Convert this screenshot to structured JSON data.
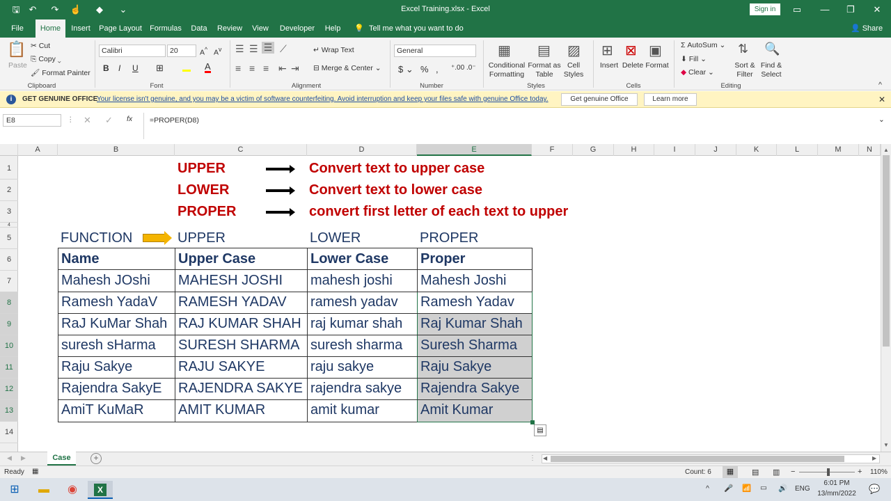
{
  "titlebar": {
    "title": "Excel Training.xlsx  -  Excel",
    "signin": "Sign in"
  },
  "tabs": [
    "File",
    "Home",
    "Insert",
    "Page Layout",
    "Formulas",
    "Data",
    "Review",
    "View",
    "Developer",
    "Help"
  ],
  "tellme": "Tell me what you want to do",
  "share": "Share",
  "ribbon": {
    "clipboard": {
      "paste": "Paste",
      "cut": "Cut",
      "copy": "Copy",
      "format_painter": "Format Painter",
      "label": "Clipboard"
    },
    "font": {
      "name": "Calibri",
      "size": "20",
      "label": "Font"
    },
    "alignment": {
      "wrap": "Wrap Text",
      "merge": "Merge & Center",
      "label": "Alignment"
    },
    "number": {
      "format": "General",
      "label": "Number"
    },
    "styles": {
      "conditional": "Conditional\nFormatting",
      "format_table": "Format as\nTable",
      "cell_styles": "Cell\nStyles",
      "label": "Styles"
    },
    "cells": {
      "insert": "Insert",
      "delete": "Delete",
      "format": "Format",
      "label": "Cells"
    },
    "editing": {
      "autosum": "AutoSum",
      "fill": "Fill",
      "clear": "Clear",
      "sort": "Sort &\nFilter",
      "find": "Find &\nSelect",
      "label": "Editing"
    }
  },
  "license": {
    "title": "GET GENUINE OFFICE",
    "message": "Your license isn't genuine, and you may be a victim of software counterfeiting. Avoid interruption and keep your files safe with genuine Office today.",
    "btn1": "Get genuine Office",
    "btn2": "Learn more"
  },
  "formula": {
    "namebox": "E8",
    "fx": "fx",
    "content": "=PROPER(D8)"
  },
  "columns": [
    "A",
    "B",
    "C",
    "D",
    "E",
    "F",
    "G",
    "H",
    "I",
    "J",
    "K",
    "L",
    "M",
    "N"
  ],
  "rows": [
    "1",
    "2",
    "3",
    "4",
    "5",
    "6",
    "7",
    "8",
    "9",
    "10",
    "11",
    "12",
    "13",
    "14"
  ],
  "sheet": {
    "r1": {
      "func": "UPPER",
      "desc": "Convert text to upper case"
    },
    "r2": {
      "func": "LOWER",
      "desc": "Convert text to lower case"
    },
    "r3": {
      "func": "PROPER",
      "desc": "convert first letter of each text to upper"
    },
    "r5": {
      "b": "FUNCTION",
      "c": "UPPER",
      "d": "LOWER",
      "e": "PROPER"
    },
    "header": {
      "b": "Name",
      "c": "Upper Case",
      "d": "Lower Case",
      "e": "Proper"
    },
    "data": [
      [
        "Mahesh JOshi",
        "MAHESH JOSHI",
        "mahesh joshi",
        "Mahesh Joshi"
      ],
      [
        "Ramesh YadaV",
        "RAMESH YADAV",
        "ramesh yadav",
        "Ramesh Yadav"
      ],
      [
        "RaJ KuMar Shah",
        "RAJ KUMAR SHAH",
        "raj kumar shah",
        "Raj Kumar Shah"
      ],
      [
        "suresh sHarma",
        "SURESH SHARMA",
        "suresh sharma",
        "Suresh Sharma"
      ],
      [
        "Raju Sakye",
        "RAJU SAKYE",
        "raju sakye",
        "Raju Sakye"
      ],
      [
        "Rajendra SakyE",
        "RAJENDRA SAKYE",
        "rajendra sakye",
        "Rajendra Sakye"
      ],
      [
        "AmiT KuMaR",
        "AMIT KUMAR",
        "amit kumar",
        "Amit Kumar"
      ]
    ]
  },
  "sheet_tab": "Case",
  "status": {
    "ready": "Ready",
    "count": "Count: 6",
    "zoom": "110%"
  },
  "taskbar": {
    "lang": "ENG",
    "time": "6:01 PM",
    "date": "13/mm/2022"
  }
}
